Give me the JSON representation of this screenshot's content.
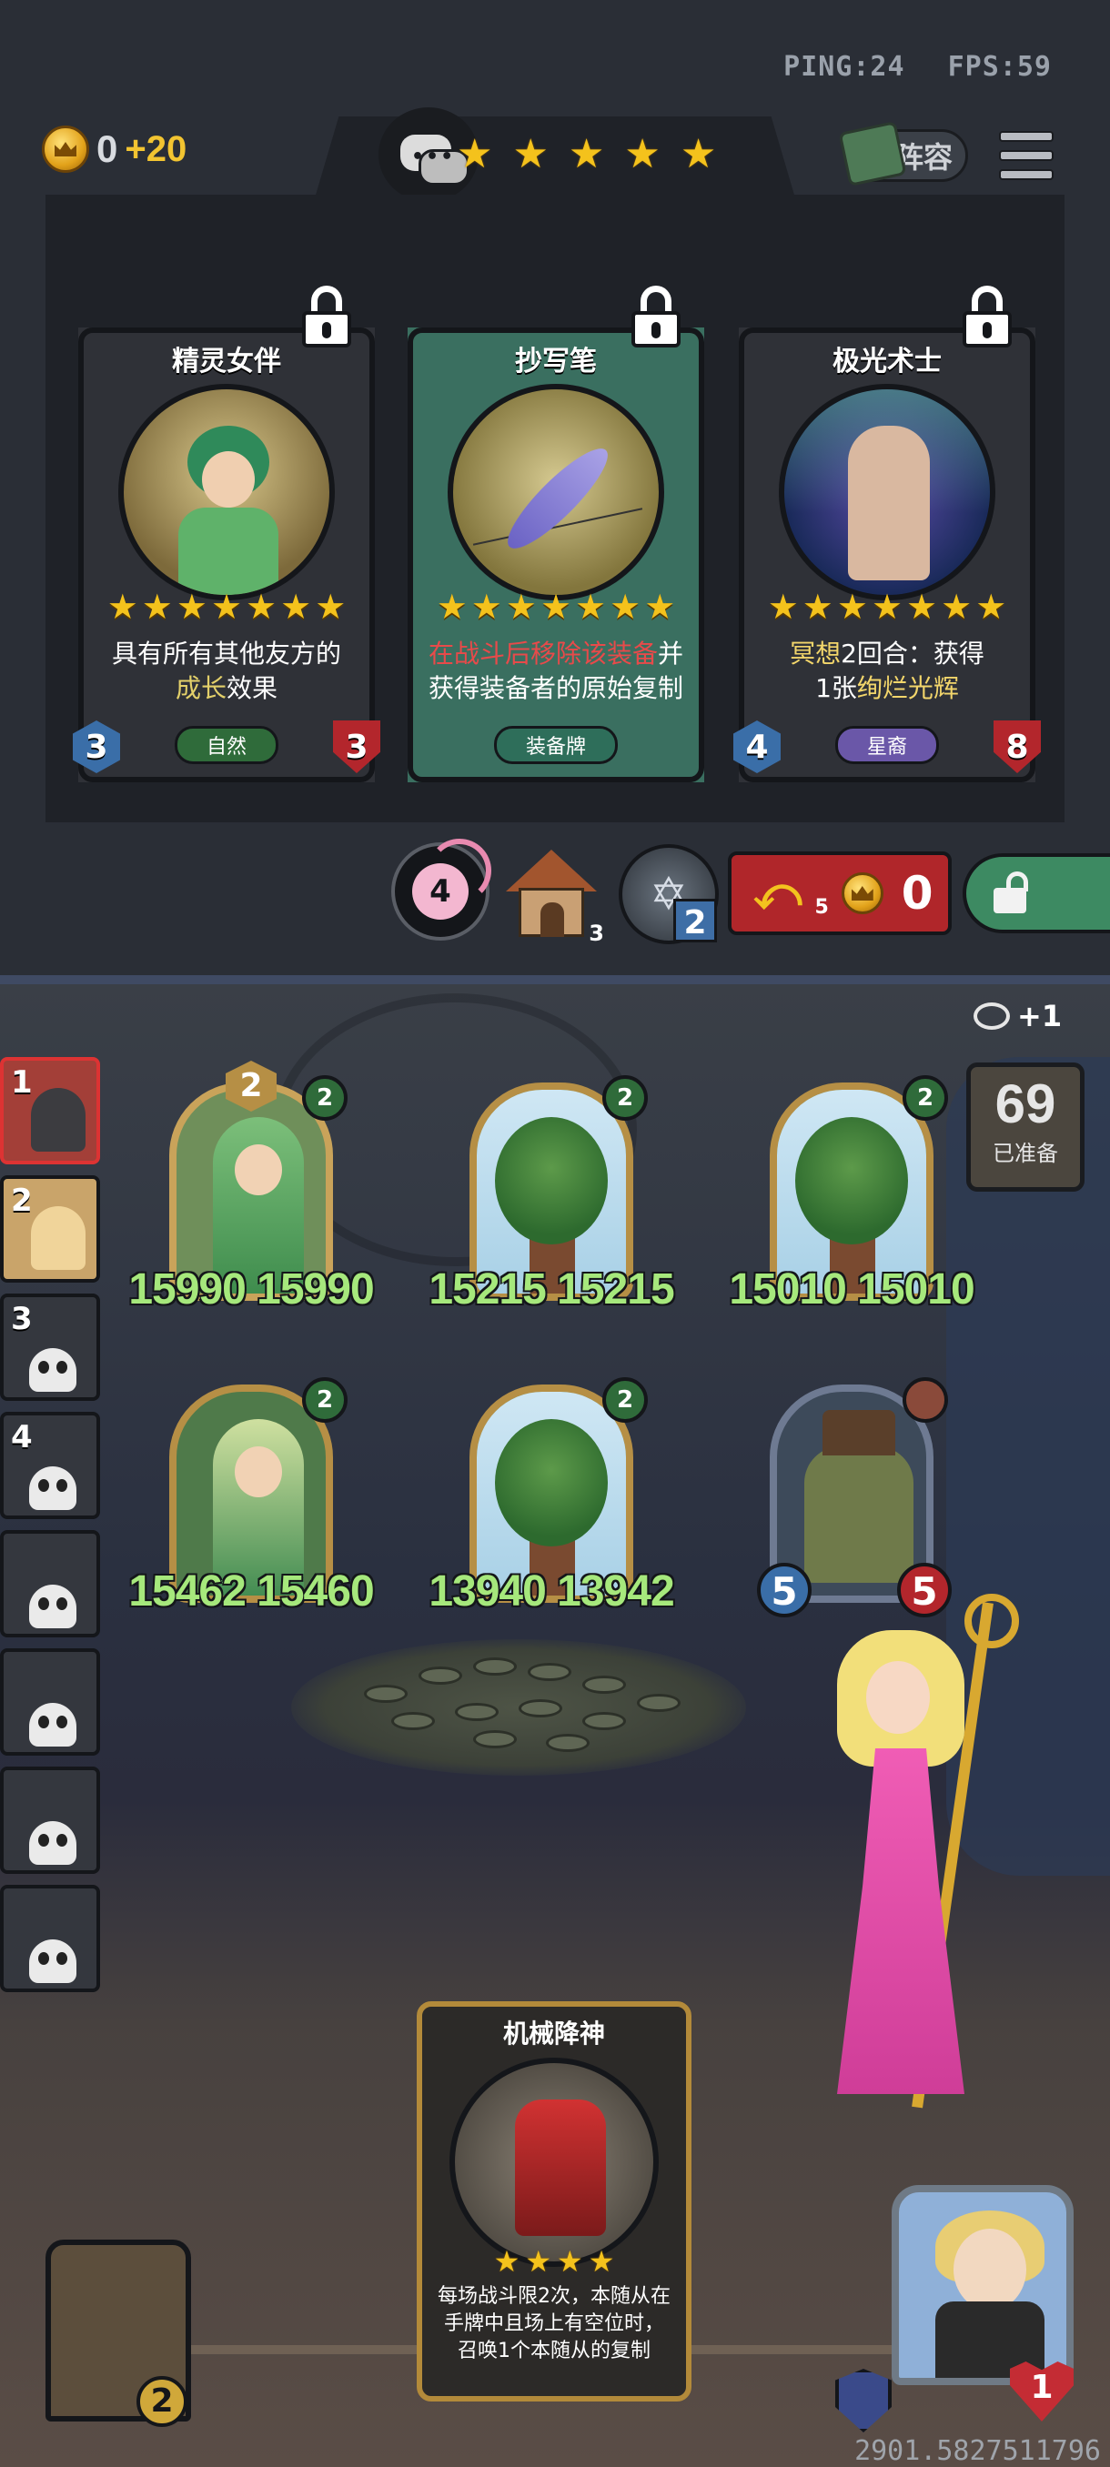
{
  "hud": {
    "ping": "PING:24",
    "fps": "FPS:59"
  },
  "gold": {
    "amount": "0",
    "income": "+20"
  },
  "tier_stars": [
    "★",
    "★",
    "★",
    "★",
    "★"
  ],
  "buttons": {
    "lineup": "阵容"
  },
  "shop_cards": [
    {
      "name": "精灵女伴",
      "stars": 7,
      "desc_parts": [
        "具有所有其他友方的",
        "成长",
        "效果"
      ],
      "tribe": "自然",
      "attack": "3",
      "health": "3"
    },
    {
      "name": "抄写笔",
      "stars": 7,
      "desc_parts": [
        "在战斗后移除该装备",
        "并",
        "获得装备者的原始复制"
      ],
      "tribe": "装备牌"
    },
    {
      "name": "极光术士",
      "stars": 7,
      "desc_parts": [
        "冥想",
        "2回合：获得",
        "1张",
        "绚烂光辉"
      ],
      "tribe": "星裔",
      "attack": "4",
      "health": "8"
    }
  ],
  "shop_actions": {
    "flower_count": "4",
    "house_count": "3",
    "compass_count": "2",
    "refresh_count": "5",
    "refresh_cost": "0"
  },
  "turn": {
    "bonus": "+1",
    "number": "69",
    "label": "已准备"
  },
  "roster": [
    {
      "rank": "1",
      "state": "active"
    },
    {
      "rank": "2",
      "state": "alive"
    },
    {
      "rank": "3",
      "state": "dead"
    },
    {
      "rank": "4",
      "state": "dead"
    },
    {
      "rank": "",
      "state": "dead"
    },
    {
      "rank": "",
      "state": "dead"
    },
    {
      "rank": "",
      "state": "dead"
    },
    {
      "rank": "",
      "state": "dead"
    }
  ],
  "board": [
    {
      "kind": "fairy",
      "level": "2",
      "tribe": "2",
      "stats": "15990 15990"
    },
    {
      "kind": "tree",
      "tribe": "2",
      "stats": "15215 15215"
    },
    {
      "kind": "tree",
      "tribe": "2",
      "stats": "15010 15010"
    },
    {
      "kind": "elf",
      "tribe": "2",
      "stats": "15462 15460"
    },
    {
      "kind": "tree",
      "tribe": "2",
      "stats": "13940 13942"
    },
    {
      "kind": "toad",
      "attack": "5",
      "health": "5"
    }
  ],
  "hand_card": {
    "name": "机械降神",
    "stars": 4,
    "desc": "每场战斗限2次，本随从在手牌中且场上有空位时，召唤1个本随从的复制"
  },
  "chest": {
    "count": "2"
  },
  "hero": {
    "health": "1"
  },
  "coords": "2901.5827511796",
  "colors": {
    "gold": "#f4c21c",
    "stat_green": "#a6e87c",
    "refresh_red": "#b0262a",
    "lock_green": "#3d8a62"
  }
}
